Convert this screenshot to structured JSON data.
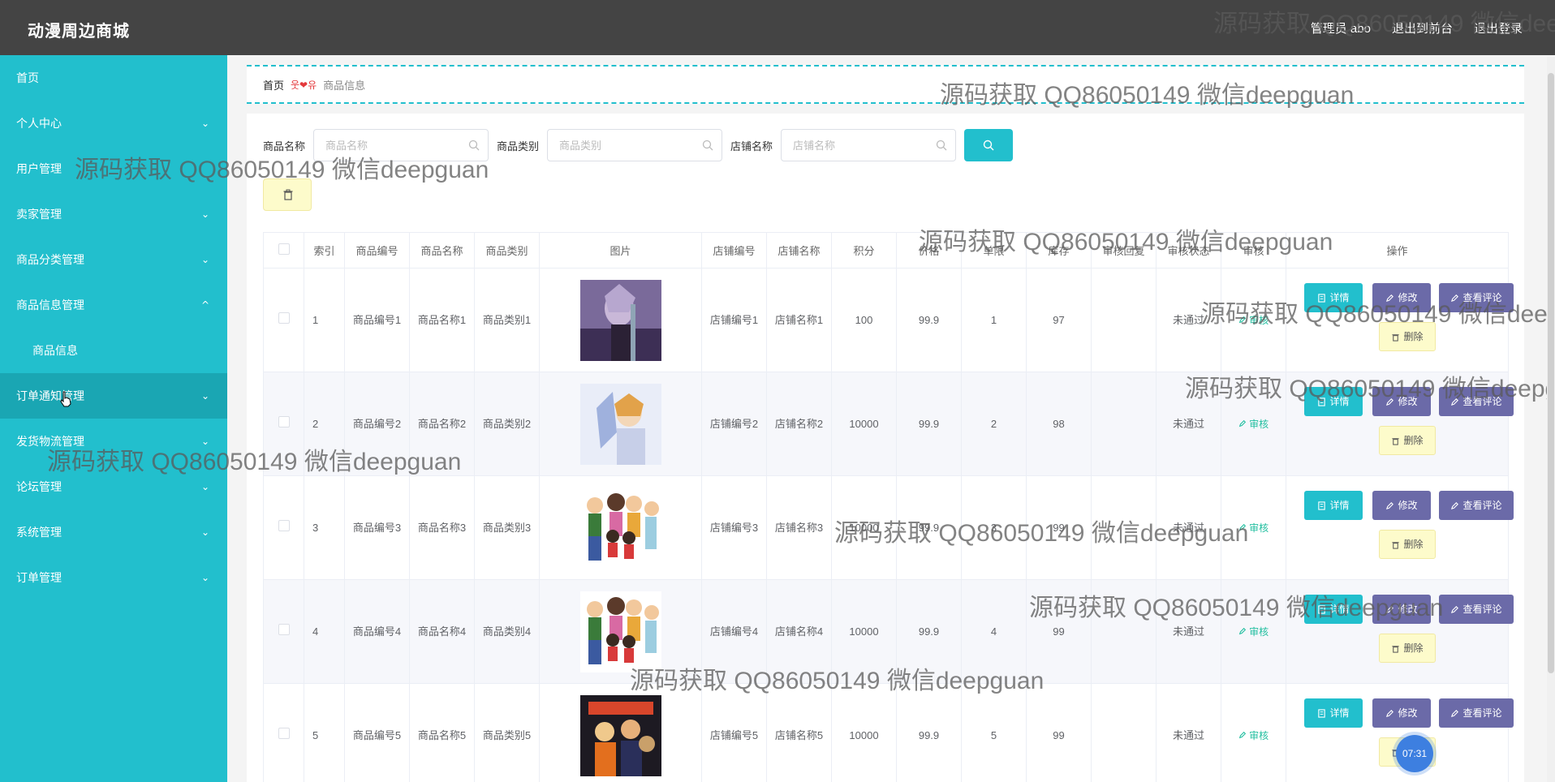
{
  "header": {
    "brand": "动漫周边商城",
    "user_label": "管理员 abo",
    "front_label": "退出到前台",
    "logout_label": "退出登录"
  },
  "sidebar": {
    "items": [
      {
        "label": "首页",
        "expandable": false
      },
      {
        "label": "个人中心",
        "expandable": true
      },
      {
        "label": "用户管理",
        "expandable": false
      },
      {
        "label": "卖家管理",
        "expandable": true
      },
      {
        "label": "商品分类管理",
        "expandable": true
      },
      {
        "label": "商品信息管理",
        "expandable": true,
        "expanded": true
      },
      {
        "label": "商品信息",
        "sub": true
      },
      {
        "label": "订单通知管理",
        "expandable": true,
        "hover": true
      },
      {
        "label": "发货物流管理",
        "expandable": true
      },
      {
        "label": "论坛管理",
        "expandable": true
      },
      {
        "label": "系统管理",
        "expandable": true
      },
      {
        "label": "订单管理",
        "expandable": true
      }
    ]
  },
  "breadcrumb": {
    "home": "首页",
    "separator": "웃❤유",
    "current": "商品信息"
  },
  "search": {
    "name_label": "商品名称",
    "name_placeholder": "商品名称",
    "type_label": "商品类别",
    "type_placeholder": "商品类别",
    "shop_label": "店铺名称",
    "shop_placeholder": "店铺名称"
  },
  "table": {
    "headers": [
      "索引",
      "商品编号",
      "商品名称",
      "商品类别",
      "图片",
      "店铺编号",
      "店铺名称",
      "积分",
      "价格",
      "单限",
      "库存",
      "审核回复",
      "审核状态",
      "审核",
      "操作"
    ],
    "rows": [
      {
        "index": "1",
        "code": "商品编号1",
        "name": "商品名称1",
        "type": "商品类别1",
        "shop_code": "店铺编号1",
        "shop_name": "店铺名称1",
        "points": "100",
        "price": "99.9",
        "limit": "1",
        "stock": "97",
        "reply": "",
        "status": "未通过",
        "audit": "审核"
      },
      {
        "index": "2",
        "code": "商品编号2",
        "name": "商品名称2",
        "type": "商品类别2",
        "shop_code": "店铺编号2",
        "shop_name": "店铺名称2",
        "points": "10000",
        "price": "99.9",
        "limit": "2",
        "stock": "98",
        "reply": "",
        "status": "未通过",
        "audit": "审核"
      },
      {
        "index": "3",
        "code": "商品编号3",
        "name": "商品名称3",
        "type": "商品类别3",
        "shop_code": "店铺编号3",
        "shop_name": "店铺名称3",
        "points": "10000",
        "price": "99.9",
        "limit": "3",
        "stock": "99",
        "reply": "",
        "status": "未通过",
        "audit": "审核"
      },
      {
        "index": "4",
        "code": "商品编号4",
        "name": "商品名称4",
        "type": "商品类别4",
        "shop_code": "店铺编号4",
        "shop_name": "店铺名称4",
        "points": "10000",
        "price": "99.9",
        "limit": "4",
        "stock": "99",
        "reply": "",
        "status": "未通过",
        "audit": "审核"
      },
      {
        "index": "5",
        "code": "商品编号5",
        "name": "商品名称5",
        "type": "商品类别5",
        "shop_code": "店铺编号5",
        "shop_name": "店铺名称5",
        "points": "10000",
        "price": "99.9",
        "limit": "5",
        "stock": "99",
        "reply": "",
        "status": "未通过",
        "audit": "审核"
      }
    ],
    "actions": {
      "detail": "详情",
      "edit": "修改",
      "review": "查看评论",
      "delete": "删除"
    }
  },
  "watermark": "源码获取 QQ86050149 微信deepguan",
  "timer": "07:31",
  "colors": {
    "accent": "#22bfcd",
    "topbar": "#444444",
    "purple": "#6b6aa8",
    "yellow": "#fdfbcb"
  }
}
